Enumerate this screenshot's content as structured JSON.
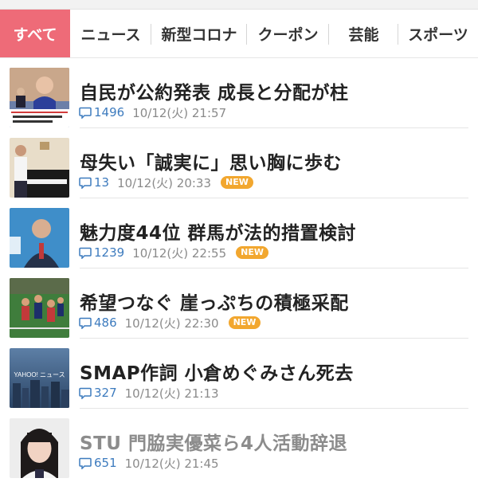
{
  "tabs": [
    {
      "label": "すべて",
      "active": true
    },
    {
      "label": "ニュース",
      "active": false
    },
    {
      "label": "新型コロナ",
      "active": false
    },
    {
      "label": "クーポン",
      "active": false
    },
    {
      "label": "芸能",
      "active": false
    },
    {
      "label": "スポーツ",
      "active": false
    }
  ],
  "articles": [
    {
      "title": "自民が公約発表 成長と分配が柱",
      "comments": "1496",
      "date": "10/12(火) 21:57",
      "new": "",
      "read": false
    },
    {
      "title": "母失い「誠実に」思い胸に歩む",
      "comments": "13",
      "date": "10/12(火) 20:33",
      "new": "NEW",
      "read": false
    },
    {
      "title": "魅力度44位 群馬が法的措置検討",
      "comments": "1239",
      "date": "10/12(火) 22:55",
      "new": "NEW",
      "read": false
    },
    {
      "title": "希望つなぐ 崖っぷちの積極采配",
      "comments": "486",
      "date": "10/12(火) 22:30",
      "new": "NEW",
      "read": false
    },
    {
      "title": "SMAP作詞 小倉めぐみさん死去",
      "comments": "327",
      "date": "10/12(火) 21:13",
      "new": "",
      "read": false
    },
    {
      "title": "STU 門脇実優菜ら4人活動辞退",
      "comments": "651",
      "date": "10/12(火) 21:45",
      "new": "",
      "read": true
    }
  ],
  "thumbnails": {
    "article1_caption": "成長と「分配」を柱とした政策で新たな成長軌道に乗せていく",
    "article5_logo": "YAHOO! ニュース"
  },
  "colors": {
    "active_tab": "#ee6b78",
    "comment_blue": "#3d7bbe",
    "new_badge": "#f2a72f"
  },
  "icons": {
    "comment": "speech-bubble-icon"
  }
}
